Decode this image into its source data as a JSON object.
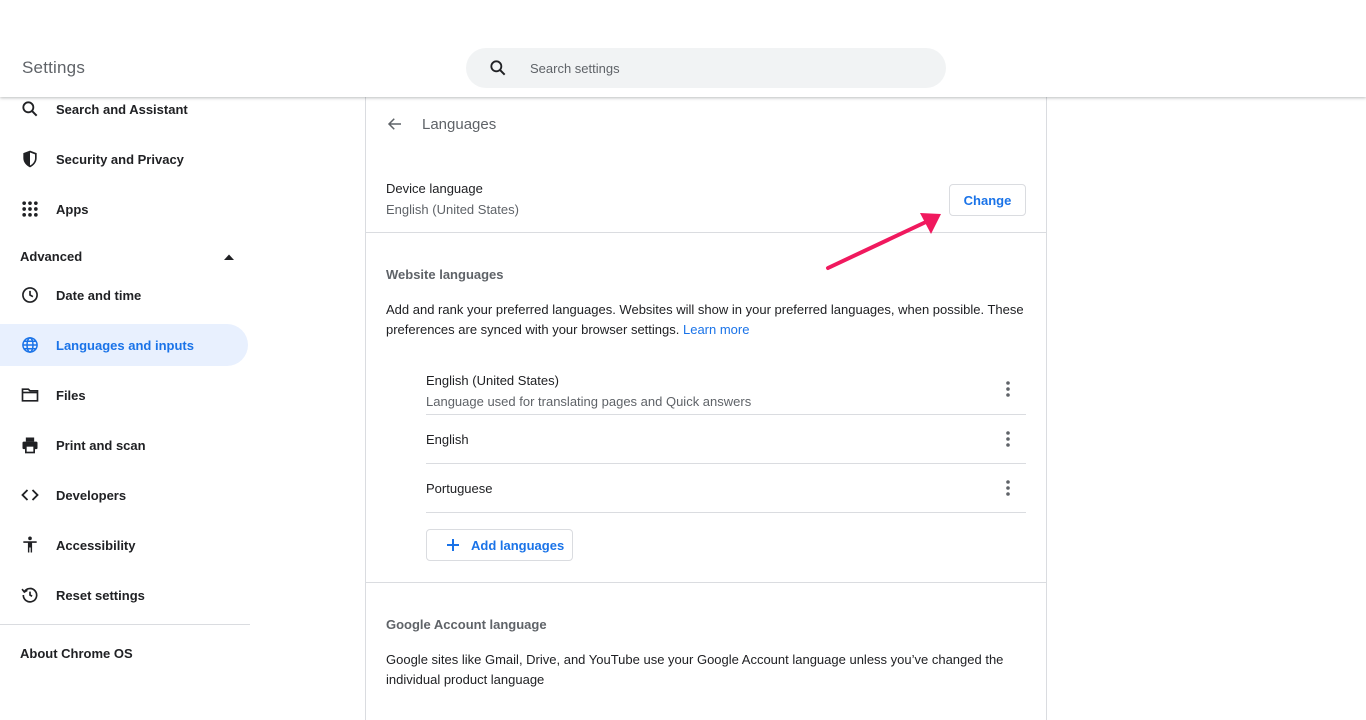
{
  "app": {
    "title": "Settings"
  },
  "search": {
    "placeholder": "Search settings"
  },
  "sidebar": {
    "items": [
      {
        "label": "Search and Assistant",
        "icon": "search-icon"
      },
      {
        "label": "Security and Privacy",
        "icon": "shield-icon"
      },
      {
        "label": "Apps",
        "icon": "apps-grid-icon"
      }
    ],
    "advanced_label": "Advanced",
    "advanced_items": [
      {
        "label": "Date and time",
        "icon": "clock-icon"
      },
      {
        "label": "Languages and inputs",
        "icon": "globe-icon",
        "active": true
      },
      {
        "label": "Files",
        "icon": "folder-icon"
      },
      {
        "label": "Print and scan",
        "icon": "printer-icon"
      },
      {
        "label": "Developers",
        "icon": "code-icon"
      },
      {
        "label": "Accessibility",
        "icon": "accessibility-icon"
      },
      {
        "label": "Reset settings",
        "icon": "reset-icon"
      }
    ],
    "about_label": "About Chrome OS"
  },
  "page": {
    "title": "Languages",
    "device_language": {
      "label": "Device language",
      "value": "English (United States)",
      "button_label": "Change"
    },
    "website_languages": {
      "title": "Website languages",
      "description": "Add and rank your preferred languages. Websites will show in your preferred languages, when possible. These preferences are synced with your browser settings.",
      "learn_more": "Learn more",
      "languages": [
        {
          "name": "English (United States)",
          "sub": "Language used for translating pages and Quick answers"
        },
        {
          "name": "English",
          "sub": ""
        },
        {
          "name": "Portuguese",
          "sub": ""
        }
      ],
      "add_button_label": "Add languages"
    },
    "google_account_language": {
      "title": "Google Account language",
      "description": "Google sites like Gmail, Drive, and YouTube use your Google Account language unless you’ve changed the individual product language"
    }
  },
  "colors": {
    "accent": "#1a73e8",
    "active_bg": "#e8f0fe",
    "annotation_arrow": "#f0195e"
  }
}
